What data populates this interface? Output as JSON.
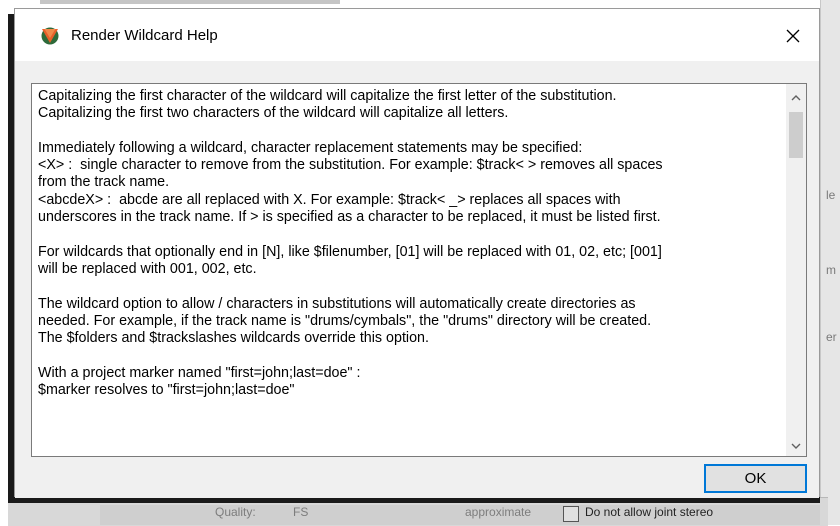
{
  "window": {
    "title": "Render Wildcard Help",
    "icon": "reaper-icon",
    "close_icon": "close-icon"
  },
  "help_text": {
    "lines": [
      "Capitalizing the first character of the wildcard will capitalize the first letter of the substitution.",
      "Capitalizing the first two characters of the wildcard will capitalize all letters.",
      "",
      "Immediately following a wildcard, character replacement statements may be specified:",
      "<X> :  single character to remove from the substitution. For example: $track< > removes all spaces",
      "from the track name.",
      "<abcdeX> :  abcde are all replaced with X. For example: $track< _> replaces all spaces with",
      "underscores in the track name. If > is specified as a character to be replaced, it must be listed first.",
      "",
      "For wildcards that optionally end in [N], like $filenumber, [01] will be replaced with 01, 02, etc; [001]",
      "will be replaced with 001, 002, etc.",
      "",
      "The wildcard option to allow / characters in substitutions will automatically create directories as",
      "needed. For example, if the track name is \"drums/cymbals\", the \"drums\" directory will be created.",
      "The $folders and $trackslashes wildcards override this option.",
      "",
      "With a project marker named \"first=john;last=doe\" :",
      "$marker resolves to \"first=john;last=doe\""
    ]
  },
  "buttons": {
    "ok_label": "OK"
  },
  "background": {
    "right_fragments": [
      "le",
      "m",
      "er"
    ],
    "bottom_left": "Quality:",
    "bottom_value": "FS",
    "bottom_mid": "approximate",
    "bottom_checkbox_label": "Do not allow joint stereo"
  },
  "colors": {
    "accent": "#0078d7",
    "dialog_bg": "#f0f0f0",
    "titlebar_bg": "#ffffff"
  }
}
